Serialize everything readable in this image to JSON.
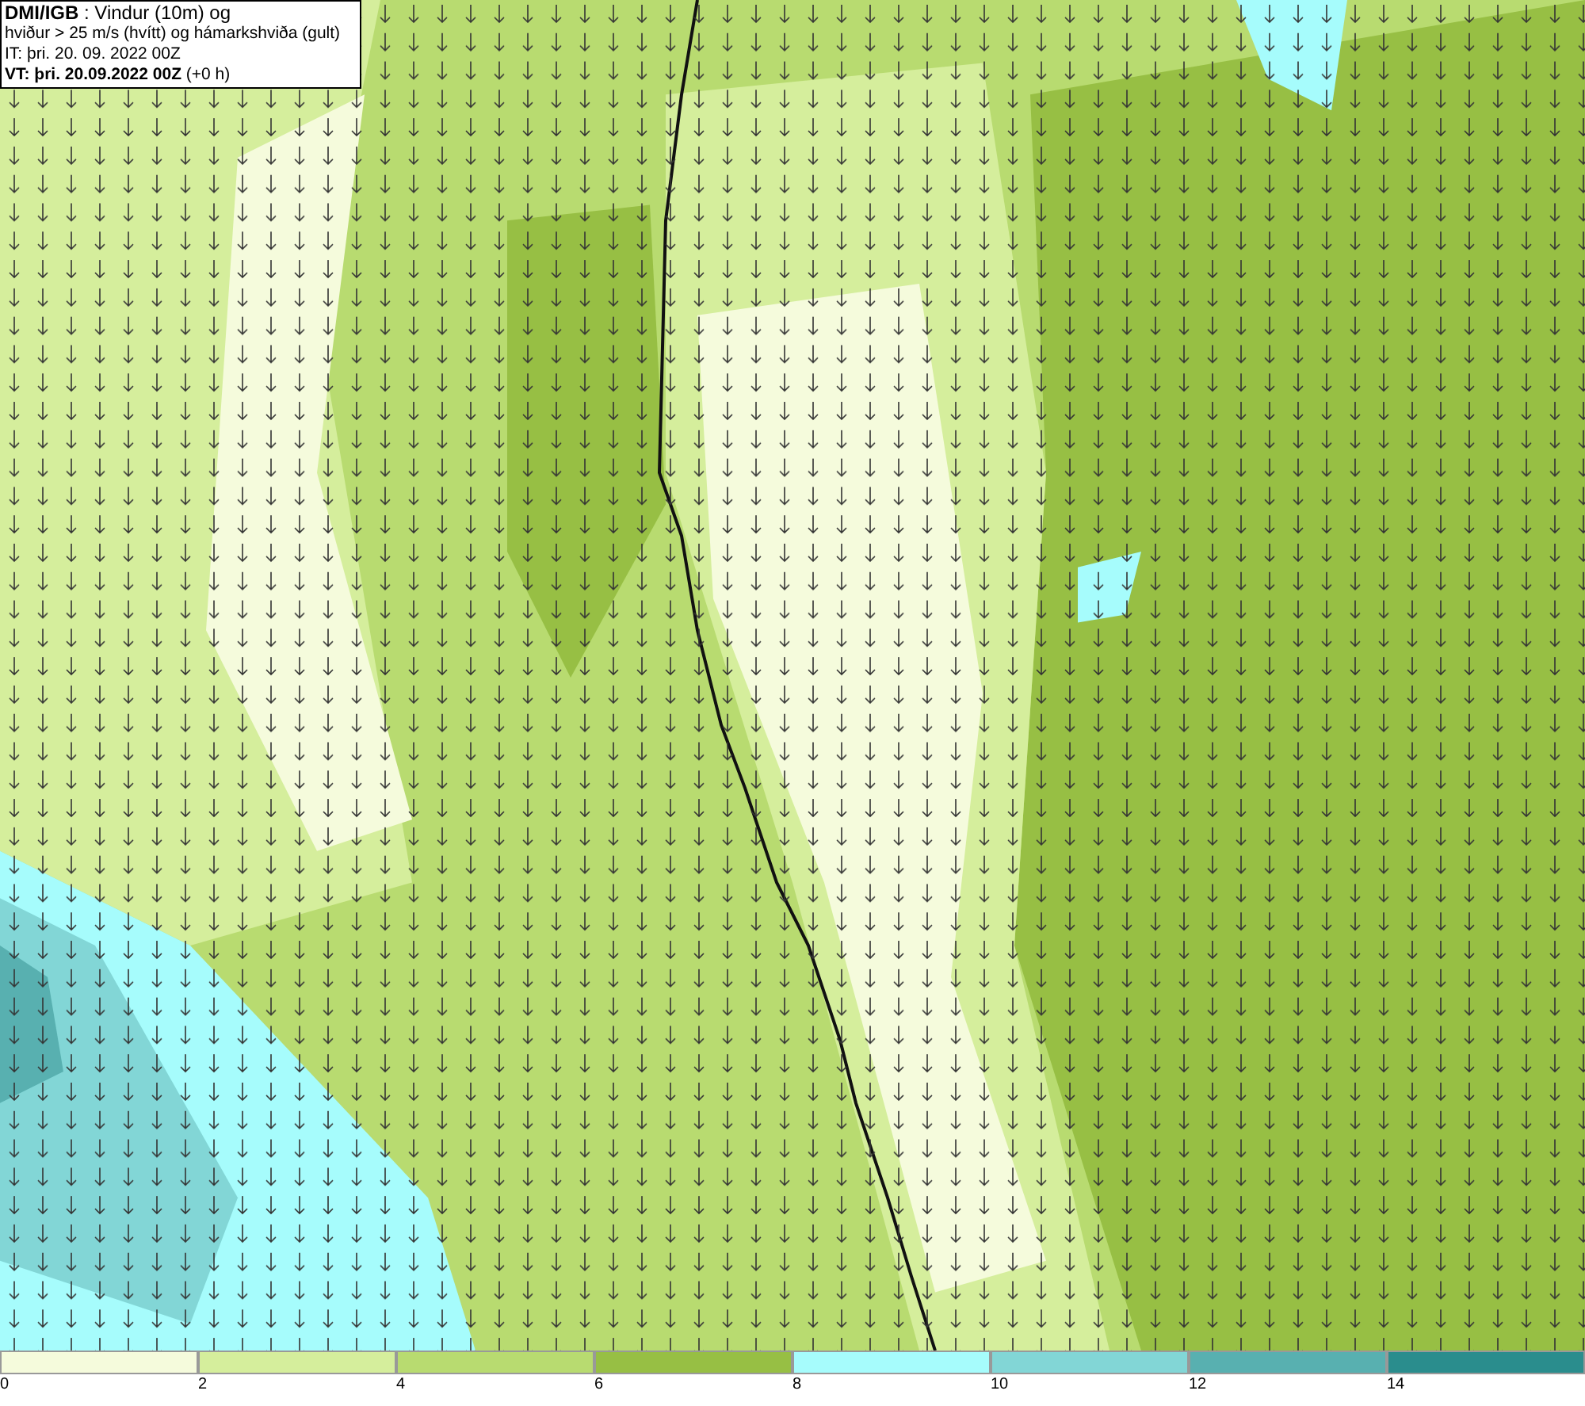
{
  "title_box": {
    "lines": [
      "**DMI/IGB** : Vindur (10m) og",
      "hviður > 25 m/s (hvítt) og hámarkshviða (gult)",
      "IT: þri. 20. 09. 2022 00Z",
      "**VT: þri. 20.09.2022 00Z** (+0 h)"
    ]
  },
  "legend": [
    {
      "label": "0",
      "color": "#f5fbdc"
    },
    {
      "label": "2",
      "color": "#d5ee9c"
    },
    {
      "label": "4",
      "color": "#b8db70"
    },
    {
      "label": "6",
      "color": "#97bf44"
    },
    {
      "label": "8",
      "color": "#a6fcfc"
    },
    {
      "label": "10",
      "color": "#82d6d6"
    },
    {
      "label": "12",
      "color": "#58b0b0"
    },
    {
      "label": "14",
      "color": "#2a8d8d"
    }
  ]
}
